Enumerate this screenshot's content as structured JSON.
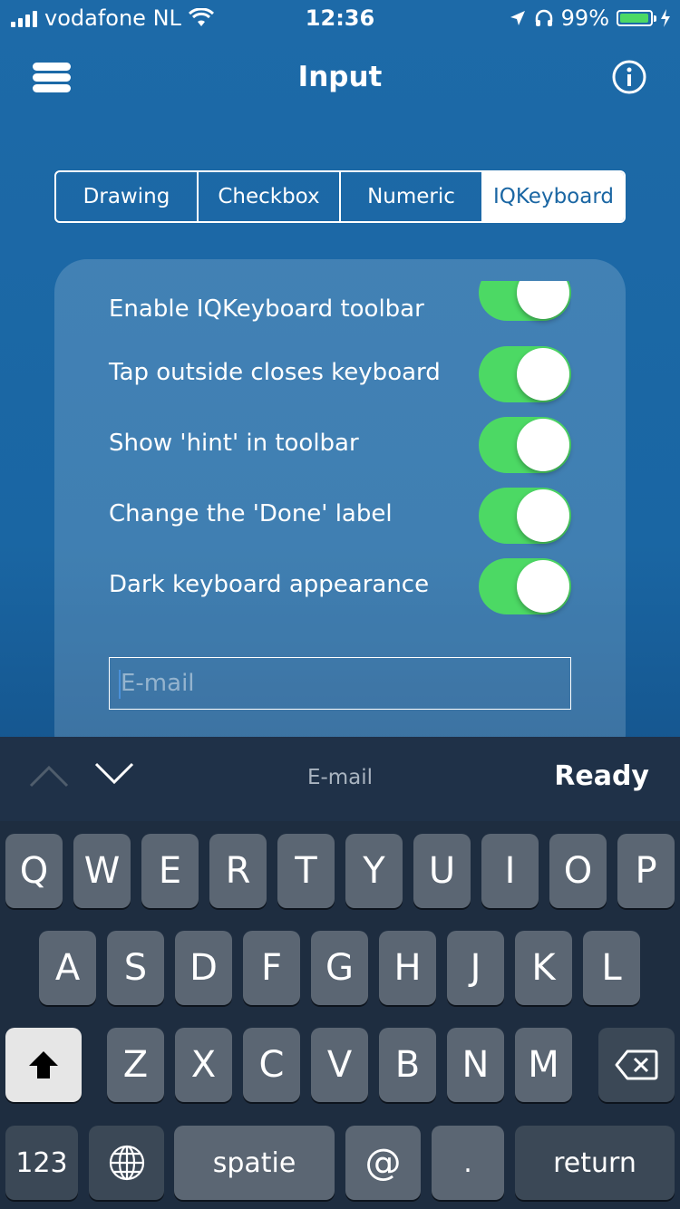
{
  "status_bar": {
    "carrier": "vodafone NL",
    "time": "12:36",
    "battery_percent": "99%",
    "signal_bars": 4,
    "icons": [
      "signal-icon",
      "wifi-icon",
      "location-icon",
      "headphones-icon",
      "battery-icon",
      "charging-icon"
    ]
  },
  "nav": {
    "title": "Input",
    "left_icon": "menu-icon",
    "right_icon": "info-icon"
  },
  "segments": {
    "items": [
      {
        "label": "Drawing"
      },
      {
        "label": "Checkbox"
      },
      {
        "label": "Numeric"
      },
      {
        "label": "IQKeyboard"
      }
    ],
    "selected": "IQKeyboard"
  },
  "settings": {
    "rows": [
      {
        "label": "Enable IQKeyboard toolbar",
        "on": true
      },
      {
        "label": "Tap outside closes keyboard",
        "on": true
      },
      {
        "label": "Show 'hint' in toolbar",
        "on": true
      },
      {
        "label": "Change the 'Done' label",
        "on": true
      },
      {
        "label": "Dark keyboard appearance",
        "on": true
      }
    ],
    "email_placeholder": "E-mail"
  },
  "keyboard_toolbar": {
    "hint": "E-mail",
    "done_label": "Ready",
    "icons": [
      "chevron-up-icon",
      "chevron-down-icon"
    ]
  },
  "keyboard": {
    "row1": [
      "Q",
      "W",
      "E",
      "R",
      "T",
      "Y",
      "U",
      "I",
      "O",
      "P"
    ],
    "row2": [
      "A",
      "S",
      "D",
      "F",
      "G",
      "H",
      "J",
      "K",
      "L"
    ],
    "row3": [
      "Z",
      "X",
      "C",
      "V",
      "B",
      "N",
      "M"
    ],
    "numbers_label": "123",
    "space_label": "spatie",
    "at_label": "@",
    "dot_label": ".",
    "return_label": "return",
    "icons": [
      "shift-icon",
      "backspace-icon",
      "globe-icon"
    ]
  },
  "colors": {
    "background": "#1a66a3",
    "toggle_on": "#4cd964",
    "keyboard_bg": "#1e2d40",
    "key": "#5b6673"
  }
}
